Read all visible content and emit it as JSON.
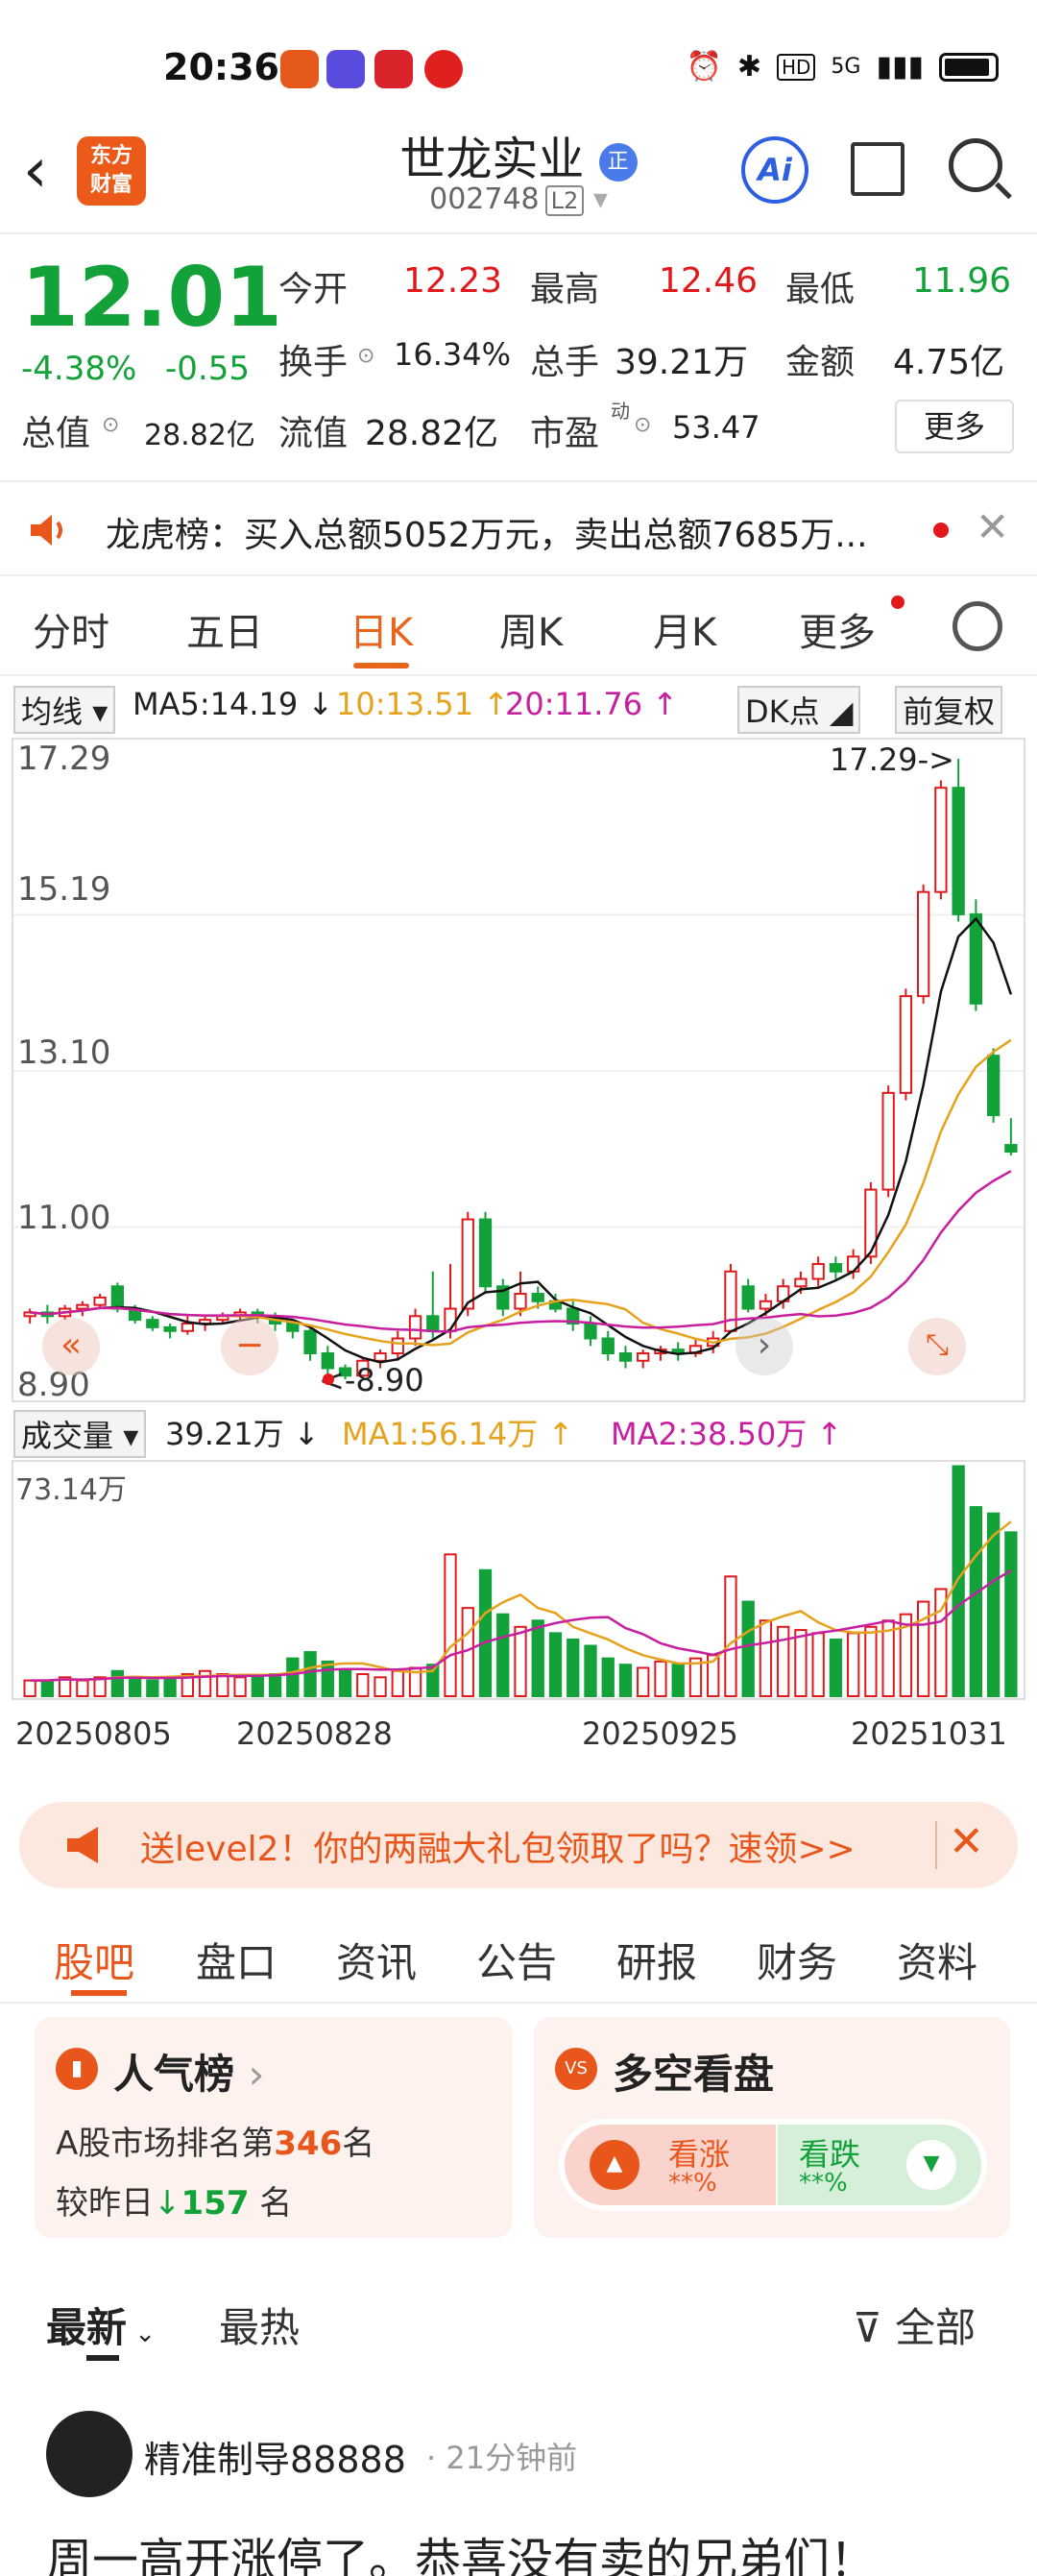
{
  "status_bar": {
    "time": "20:36",
    "signal": "5G"
  },
  "header": {
    "logo_text": "东方\n财富",
    "title": "世龙实业",
    "title_badge": "正",
    "code": "002748",
    "level_badge": "L2",
    "ai_label": "Ai"
  },
  "quote": {
    "price": "12.01",
    "change_pct": "-4.38%",
    "change_amt": "-0.55",
    "open_label": "今开",
    "open": "12.23",
    "high_label": "最高",
    "high": "12.46",
    "low_label": "最低",
    "low": "11.96",
    "turnover_label": "换手",
    "turnover": "16.34%",
    "volume_label": "总手",
    "volume": "39.21万",
    "amount_label": "金额",
    "amount": "4.75亿",
    "total_mv_label": "总值",
    "total_mv": "28.82亿",
    "float_mv_label": "流值",
    "float_mv": "28.82亿",
    "pe_label": "市盈",
    "pe_sup": "动",
    "pe": "53.47",
    "more_label": "更多"
  },
  "dragon_tiger": {
    "text": "龙虎榜：买入总额5052万元，卖出总额7685万..."
  },
  "chart_tabs": [
    "分时",
    "五日",
    "日K",
    "周K",
    "月K",
    "更多"
  ],
  "indicators": {
    "ma_select": "均线",
    "ma5": "MA5:14.19",
    "ma10": "10:13.51",
    "ma20": "20:11.76",
    "dk": "DK点",
    "adjust": "前复权"
  },
  "k_axis": [
    "17.29",
    "15.19",
    "13.10",
    "11.00",
    "8.90"
  ],
  "k_annot": {
    "high": "17.29->",
    "low": "<-8.90"
  },
  "volume": {
    "select": "成交量",
    "value": "39.21万",
    "ma1": "MA1:56.14万",
    "ma2": "MA2:38.50万",
    "max": "73.14万"
  },
  "dates": [
    "20250805",
    "20250828",
    "20250925",
    "20251031"
  ],
  "promo": {
    "text": "送level2！你的两融大礼包领取了吗？速领>>"
  },
  "bottom_tabs": [
    "股吧",
    "盘口",
    "资讯",
    "公告",
    "研报",
    "财务",
    "资料"
  ],
  "popularity": {
    "title": "人气榜",
    "rank_prefix": "A股市场排名第",
    "rank": "346",
    "rank_suffix": "名",
    "change_prefix": "较昨日",
    "change": "157",
    "change_suffix": "名"
  },
  "bull_bear": {
    "title": "多空看盘",
    "bull_label": "看涨",
    "bull_pct": "**%",
    "bear_label": "看跌",
    "bear_pct": "**%"
  },
  "sort": {
    "latest": "最新",
    "hot": "最热",
    "filter": "全部"
  },
  "post": {
    "user": "精准制导88888",
    "time": "· 21分钟前",
    "text": "周一高开涨停了。恭喜没有卖的兄弟们！"
  },
  "chart_data": {
    "type": "candlestick",
    "ylim": [
      8.9,
      17.29
    ],
    "candles": [
      [
        9.8,
        9.85,
        9.7,
        9.9
      ],
      [
        9.85,
        9.8,
        9.7,
        9.95
      ],
      [
        9.8,
        9.9,
        9.75,
        9.95
      ],
      [
        9.9,
        9.95,
        9.8,
        10.0
      ],
      [
        9.95,
        10.05,
        9.9,
        10.1
      ],
      [
        10.2,
        9.9,
        9.85,
        10.25
      ],
      [
        9.9,
        9.75,
        9.7,
        9.95
      ],
      [
        9.75,
        9.65,
        9.6,
        9.8
      ],
      [
        9.65,
        9.6,
        9.5,
        9.7
      ],
      [
        9.6,
        9.7,
        9.55,
        9.8
      ],
      [
        9.7,
        9.75,
        9.6,
        9.8
      ],
      [
        9.75,
        9.8,
        9.7,
        9.85
      ],
      [
        9.8,
        9.85,
        9.75,
        9.9
      ],
      [
        9.85,
        9.8,
        9.7,
        9.9
      ],
      [
        9.8,
        9.7,
        9.6,
        9.85
      ],
      [
        9.7,
        9.6,
        9.5,
        9.75
      ],
      [
        9.6,
        9.3,
        9.2,
        9.65
      ],
      [
        9.3,
        9.1,
        8.9,
        9.4
      ],
      [
        9.1,
        9.0,
        8.95,
        9.15
      ],
      [
        9.0,
        9.2,
        8.95,
        9.25
      ],
      [
        9.2,
        9.3,
        9.1,
        9.35
      ],
      [
        9.3,
        9.5,
        9.2,
        9.6
      ],
      [
        9.5,
        9.8,
        9.4,
        9.9
      ],
      [
        9.8,
        9.6,
        9.5,
        10.4
      ],
      [
        9.6,
        9.9,
        9.5,
        10.5
      ],
      [
        9.9,
        11.1,
        9.8,
        11.2
      ],
      [
        11.1,
        10.2,
        10.1,
        11.2
      ],
      [
        10.2,
        9.9,
        9.8,
        10.3
      ],
      [
        9.9,
        10.1,
        9.8,
        10.4
      ],
      [
        10.1,
        10.0,
        9.9,
        10.2
      ],
      [
        10.0,
        9.9,
        9.85,
        10.1
      ],
      [
        9.9,
        9.7,
        9.6,
        10.0
      ],
      [
        9.7,
        9.5,
        9.4,
        9.8
      ],
      [
        9.5,
        9.3,
        9.2,
        9.6
      ],
      [
        9.3,
        9.2,
        9.1,
        9.4
      ],
      [
        9.2,
        9.3,
        9.1,
        9.35
      ],
      [
        9.3,
        9.35,
        9.2,
        9.4
      ],
      [
        9.35,
        9.3,
        9.2,
        9.45
      ],
      [
        9.3,
        9.4,
        9.25,
        9.5
      ],
      [
        9.4,
        9.5,
        9.3,
        9.6
      ],
      [
        9.6,
        10.4,
        9.6,
        10.5
      ],
      [
        10.2,
        9.9,
        9.85,
        10.3
      ],
      [
        9.9,
        10.0,
        9.8,
        10.1
      ],
      [
        10.0,
        10.2,
        9.9,
        10.3
      ],
      [
        10.2,
        10.3,
        10.1,
        10.4
      ],
      [
        10.3,
        10.5,
        10.2,
        10.6
      ],
      [
        10.5,
        10.4,
        10.3,
        10.6
      ],
      [
        10.4,
        10.6,
        10.3,
        10.7
      ],
      [
        10.6,
        11.5,
        10.5,
        11.6
      ],
      [
        11.5,
        12.8,
        11.4,
        12.9
      ],
      [
        12.8,
        14.1,
        12.7,
        14.2
      ],
      [
        14.1,
        15.5,
        14.0,
        15.6
      ],
      [
        15.5,
        16.9,
        15.4,
        17.0
      ],
      [
        16.9,
        15.2,
        15.1,
        17.29
      ],
      [
        15.2,
        14.0,
        13.9,
        15.4
      ],
      [
        13.3,
        12.5,
        12.4,
        13.4
      ],
      [
        12.1,
        12.01,
        11.96,
        12.46
      ]
    ],
    "ma5_last": 14.19,
    "ma10_last": 13.51,
    "ma20_last": 11.76,
    "volume_max": 73.14,
    "volumes": [
      5,
      5,
      6,
      5,
      6,
      8,
      6,
      5,
      6,
      7,
      8,
      7,
      6,
      6,
      7,
      12,
      14,
      11,
      8,
      7,
      6,
      8,
      9,
      10,
      45,
      28,
      40,
      26,
      22,
      24,
      20,
      18,
      16,
      12,
      10,
      9,
      11,
      10,
      12,
      13,
      38,
      30,
      24,
      22,
      21,
      20,
      18,
      20,
      22,
      24,
      26,
      30,
      34,
      73,
      60,
      58,
      52
    ]
  }
}
